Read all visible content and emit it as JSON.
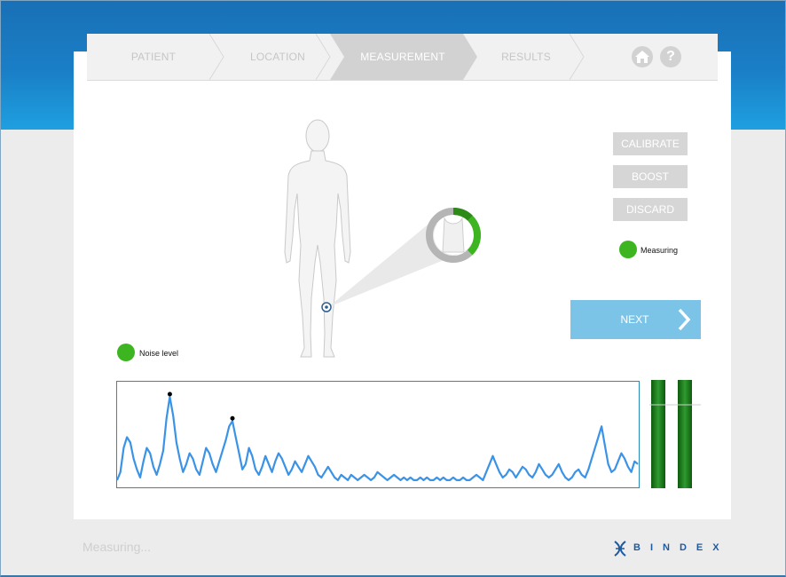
{
  "steps": [
    "PATIENT",
    "LOCATION",
    "MEASUREMENT",
    "RESULTS"
  ],
  "active_step": "MEASUREMENT",
  "icons": {
    "home": "home-icon",
    "help": "help-icon"
  },
  "help_glyph": "?",
  "buttons": {
    "calibrate": "CALIBRATE",
    "boost": "BOOST",
    "discard": "DISCARD",
    "next": "NEXT"
  },
  "status": {
    "measuring_label": "Measuring",
    "noise_label": "Noise level",
    "footer": "Measuring..."
  },
  "brand": "BINDEX",
  "colors": {
    "header_blue": "#1a7fc7",
    "status_green": "#3cb521",
    "signal_blue": "#3a93e6",
    "next_button": "#7cc4e7",
    "inactive_button": "#d6d6d6",
    "level_bar_green": "#1e7a1e"
  },
  "chart_data": {
    "type": "line",
    "series": [
      {
        "values": [
          2,
          5,
          14,
          18,
          16,
          10,
          6,
          3,
          9,
          14,
          12,
          7,
          4,
          8,
          13,
          25,
          33,
          26,
          16,
          10,
          5,
          8,
          12,
          10,
          6,
          4,
          9,
          14,
          12,
          8,
          5,
          9,
          13,
          17,
          22,
          24,
          18,
          12,
          6,
          8,
          14,
          11,
          6,
          4,
          7,
          11,
          8,
          5,
          9,
          12,
          10,
          7,
          4,
          6,
          9,
          7,
          5,
          8,
          11,
          9,
          7,
          4,
          3,
          5,
          7,
          5,
          3,
          2,
          4,
          3,
          2,
          4,
          3,
          2,
          3,
          4,
          3,
          2,
          3,
          5,
          4,
          3,
          2,
          3,
          4,
          3,
          2,
          3,
          2,
          3,
          2,
          2,
          3,
          2,
          3,
          2,
          2,
          3,
          2,
          3,
          2,
          2,
          3,
          2,
          2,
          3,
          2,
          2,
          3,
          4,
          3,
          2,
          5,
          8,
          11,
          8,
          5,
          3,
          4,
          6,
          5,
          3,
          5,
          7,
          6,
          4,
          3,
          5,
          8,
          6,
          4,
          3,
          4,
          6,
          8,
          5,
          3,
          2,
          3,
          5,
          6,
          4,
          3,
          6,
          10,
          14,
          18,
          22,
          15,
          8,
          5,
          6,
          9,
          12,
          10,
          7,
          5,
          9,
          8
        ]
      }
    ],
    "peak_markers": 2
  }
}
